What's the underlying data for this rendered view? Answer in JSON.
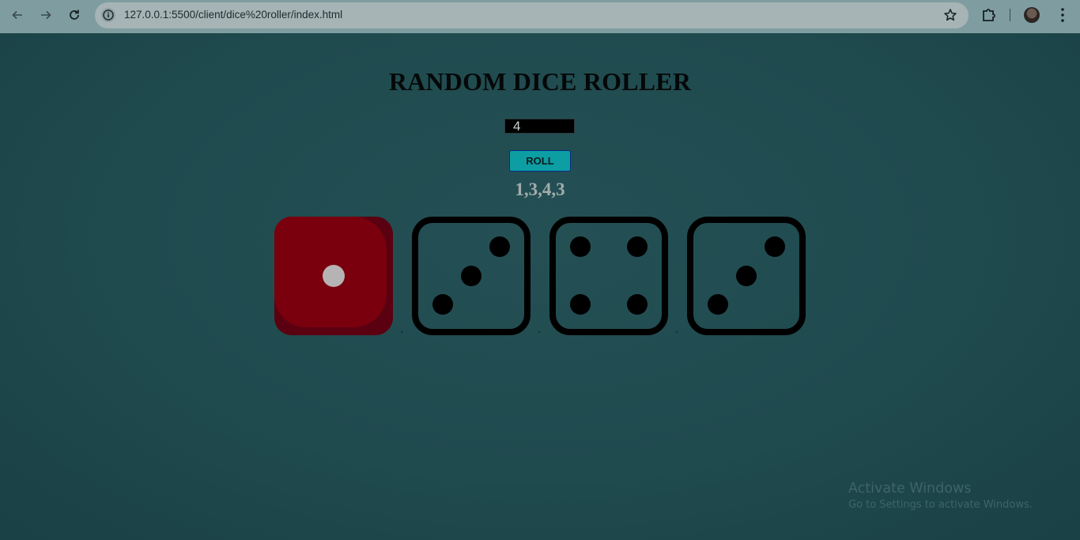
{
  "browser": {
    "url": "127.0.0.1:5500/client/dice%20roller/index.html",
    "back_icon": "arrow-left-icon",
    "forward_icon": "arrow-right-icon",
    "reload_icon": "reload-icon",
    "info_icon": "info-icon",
    "bookmark_icon": "star-icon",
    "extensions_icon": "puzzle-icon",
    "menu_icon": "kebab-menu-icon"
  },
  "app": {
    "title": "RANDOM DICE ROLLER",
    "dice_count_value": "4",
    "roll_label": "ROLL",
    "result_text": "1,3,4,3",
    "separator": ","
  },
  "dice": [
    {
      "value": 1,
      "style": "red"
    },
    {
      "value": 3,
      "style": "outline"
    },
    {
      "value": 4,
      "style": "outline"
    },
    {
      "value": 3,
      "style": "outline"
    }
  ],
  "watermark": {
    "line1": "Activate Windows",
    "line2": "Go to Settings to activate Windows."
  },
  "colors": {
    "page_background": "#1f4a4e",
    "red_die": "#7a000d",
    "roll_button": "#0c9ea3"
  }
}
